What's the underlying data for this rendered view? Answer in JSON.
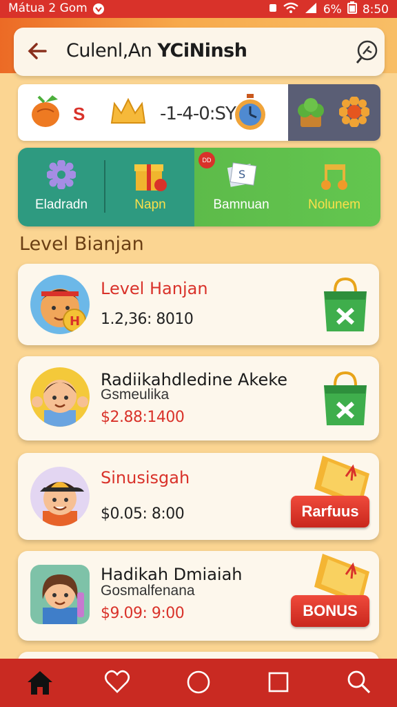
{
  "status_bar": {
    "carrier": "Mátua 2 Gom",
    "battery": "6%",
    "time": "8:50"
  },
  "search": {
    "text_part1": "Culenl,An ",
    "text_part2": "YCiNinsh"
  },
  "stats": {
    "currency_label": "S",
    "count": "-1-4-0:SY"
  },
  "tabs": [
    {
      "label": "Eladradn",
      "color": "#2e9a80"
    },
    {
      "label": "Napn",
      "color": "#2e9a80"
    },
    {
      "label": "Bamnuan",
      "color": "#5dbb4a",
      "badge": "DD"
    },
    {
      "label": "Nolunem",
      "color": "#5dbb4a"
    }
  ],
  "section_title": "Level Bianjan",
  "cards": [
    {
      "title": "Level Hanjan",
      "subtitle": "",
      "price": "1.2,36: 8010",
      "action": "bag"
    },
    {
      "title": "Radiikahdledine Akeke",
      "subtitle": "Gsmeulika",
      "price": "$2.88:1400",
      "action": "bag"
    },
    {
      "title": "Sinusisgah",
      "subtitle": "",
      "price": "$0.05: 8:00",
      "action": "button",
      "button_label": "Rarfuus"
    },
    {
      "title": "Hadikah Dmiaiah",
      "subtitle": "Gosmalfenana",
      "price": "$9.09: 9:00",
      "action": "button",
      "button_label": "BONUS"
    }
  ],
  "colors": {
    "accent": "#d9322a",
    "background": "#fbd592",
    "teal": "#2e9a80",
    "green": "#5dbb4a"
  },
  "nav": [
    "home-icon",
    "heart-icon",
    "circle-icon",
    "square-icon",
    "search-icon"
  ]
}
